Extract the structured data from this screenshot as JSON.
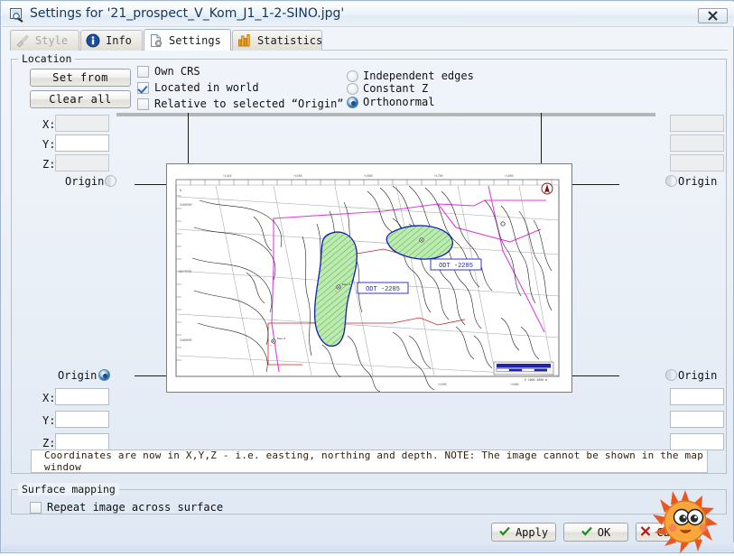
{
  "window": {
    "title": "Settings for '21_prospect_V_Kom_J1_1-2-SINO.jpg'",
    "title_icon": "image-settings-icon",
    "close_label": "✖"
  },
  "tabs": [
    {
      "label": "Style",
      "icon": "brush-icon",
      "state": "disabled"
    },
    {
      "label": "Info",
      "icon": "info-icon",
      "state": "enabled"
    },
    {
      "label": "Settings",
      "icon": "settings-page-icon",
      "state": "active"
    },
    {
      "label": "Statistics",
      "icon": "bar-chart-icon",
      "state": "enabled"
    }
  ],
  "location": {
    "group_label": "Location",
    "buttons": {
      "set_from": "Set from",
      "clear_all": "Clear all"
    },
    "checkboxes": [
      {
        "label": "Own CRS",
        "checked": false
      },
      {
        "label": "Located in world",
        "checked": true
      },
      {
        "label": "Relative to selected “Origin”",
        "checked": false
      }
    ],
    "radios": [
      {
        "label": "Independent edges",
        "selected": false
      },
      {
        "label": "Constant Z",
        "selected": false
      },
      {
        "label": "Orthonormal",
        "selected": true
      }
    ],
    "corner_labels": {
      "x": "X:",
      "y": "Y:",
      "z": "Z:",
      "origin": "Origin"
    },
    "corners": [
      {
        "name": "top-left",
        "x": "",
        "y": "",
        "z": "",
        "origin_selected": false,
        "x_enabled": false,
        "y_enabled": true,
        "z_enabled": false
      },
      {
        "name": "top-right",
        "x": "",
        "y": "",
        "z": "",
        "origin_selected": false,
        "x_enabled": false,
        "y_enabled": false,
        "z_enabled": false
      },
      {
        "name": "bottom-left",
        "x": "",
        "y": "",
        "z": "",
        "origin_selected": true,
        "x_enabled": true,
        "y_enabled": true,
        "z_enabled": true
      },
      {
        "name": "bottom-right",
        "x": "",
        "y": "",
        "z": "",
        "origin_selected": false,
        "x_enabled": true,
        "y_enabled": true,
        "z_enabled": true
      }
    ],
    "message": "Coordinates are now in X,Y,Z - i.e. easting, northing and depth. NOTE: The image cannot be shown in the map window"
  },
  "surface_mapping": {
    "group_label": "Surface mapping",
    "repeat": {
      "label": "Repeat image across surface",
      "checked": false
    }
  },
  "footer": {
    "apply": "Apply",
    "ok": "OK",
    "cancel": "Cancel"
  },
  "map": {
    "annotations": [
      {
        "text": "ODT -2285"
      },
      {
        "text": "ODT -2285"
      }
    ],
    "north_arrow": "north-arrow-icon",
    "colors": {
      "contour": "#1c1c1c",
      "closure_outline": "#1020b0",
      "closure_fill": "#9fdc8e",
      "boundary": "#e23ce2",
      "fault": "#d02020",
      "grid": "#9b9b9b"
    }
  },
  "overlay": {
    "sun_emoji": "smiling-sun-sticker"
  }
}
